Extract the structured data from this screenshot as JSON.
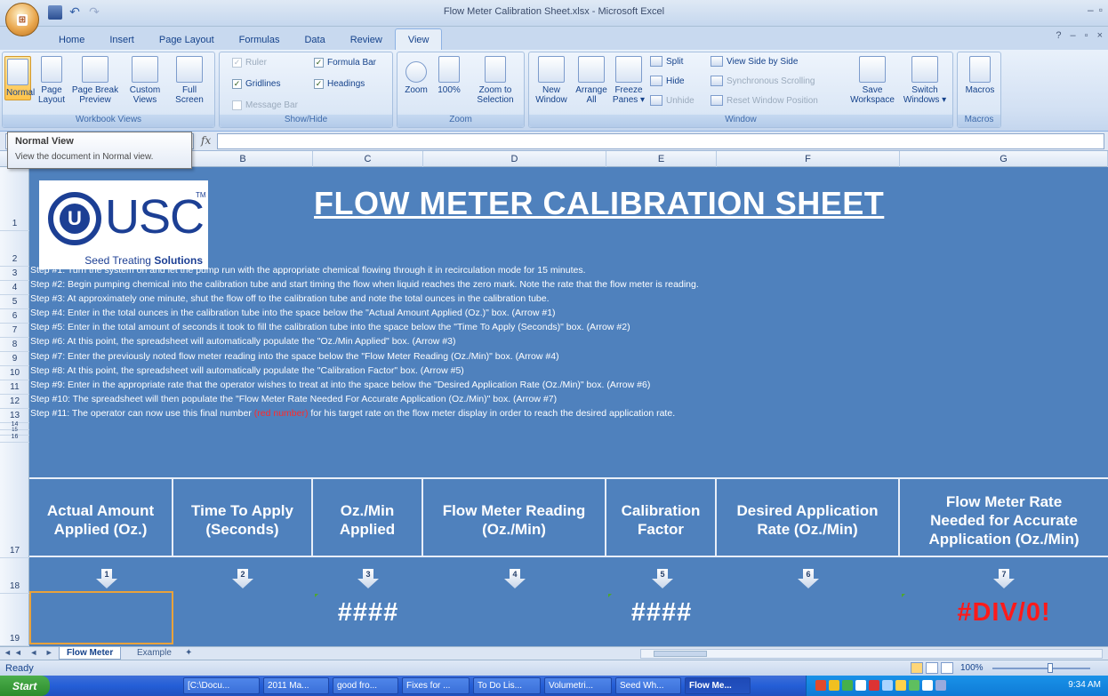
{
  "window": {
    "title": "Flow Meter Calibration Sheet.xlsx - Microsoft Excel"
  },
  "tabs": [
    "Home",
    "Insert",
    "Page Layout",
    "Formulas",
    "Data",
    "Review",
    "View"
  ],
  "ribbon": {
    "workbook_views": {
      "label": "Workbook Views",
      "normal": "Normal",
      "page_layout_1": "Page",
      "page_layout_2": "Layout",
      "page_break_1": "Page Break",
      "page_break_2": "Preview",
      "custom_1": "Custom",
      "custom_2": "Views",
      "full_1": "Full",
      "full_2": "Screen"
    },
    "show_hide": {
      "label": "Show/Hide",
      "ruler": "Ruler",
      "gridlines": "Gridlines",
      "message_bar": "Message Bar",
      "formula_bar": "Formula Bar",
      "headings": "Headings"
    },
    "zoom": {
      "label": "Zoom",
      "zoom": "Zoom",
      "hundred": "100%",
      "zoom_sel_1": "Zoom to",
      "zoom_sel_2": "Selection"
    },
    "window": {
      "label": "Window",
      "new_1": "New",
      "new_2": "Window",
      "arrange_1": "Arrange",
      "arrange_2": "All",
      "freeze_1": "Freeze",
      "freeze_2": "Panes ▾",
      "split": "Split",
      "hide": "Hide",
      "unhide": "Unhide",
      "side_by_side": "View Side by Side",
      "sync_scroll": "Synchronous Scrolling",
      "reset_pos": "Reset Window Position",
      "save_ws_1": "Save",
      "save_ws_2": "Workspace",
      "switch_1": "Switch",
      "switch_2": "Windows ▾"
    },
    "macros": {
      "label": "Macros",
      "macros": "Macros"
    }
  },
  "tooltip": {
    "title": "Normal View",
    "body": "View the document in Normal view."
  },
  "formula_bar": {
    "fx": "fx"
  },
  "columns": [
    "B",
    "C",
    "D",
    "E",
    "F",
    "G"
  ],
  "rows": [
    "1",
    "2",
    "3",
    "4",
    "5",
    "6",
    "7",
    "8",
    "9",
    "10",
    "11",
    "12",
    "13",
    "14",
    "15",
    "16",
    "17",
    "18",
    "19"
  ],
  "logo": {
    "letter": "U",
    "brand": "USC",
    "tm": "TM",
    "tag_plain": "Seed Treating ",
    "tag_bold": "Solutions"
  },
  "sheet_title": "FLOW METER CALIBRATION SHEET",
  "steps": [
    "Step #1: Turn the system on and let the pump run with the appropriate chemical flowing through it in recirculation mode for 15 minutes.",
    "Step #2: Begin pumping chemical into the calibration tube and start timing the flow when liquid reaches the zero mark.  Note the rate that the flow meter is reading.",
    "Step #3: At approximately one minute, shut the flow off to the calibration tube and note the total ounces in the calibration tube.",
    "Step #4: Enter in the total ounces in the calibration tube into the space below the \"Actual Amount Applied (Oz.)\" box. (Arrow #1)",
    "Step #5: Enter in the total amount of seconds it took to fill the calibration tube into the space below the \"Time To Apply (Seconds)\" box. (Arrow #2)",
    "Step #6: At this point, the spreadsheet will automatically populate the \"Oz./Min Applied\" box.  (Arrow #3)",
    "Step #7: Enter the previously noted flow meter reading into the space below the \"Flow Meter Reading (Oz./Min)\" box.  (Arrow #4)",
    "Step #8: At this point, the spreadsheet will automatically populate the \"Calibration Factor\" box.  (Arrow #5)",
    "Step #9: Enter in the appropriate rate that the operator wishes to treat at into the space below the \"Desired Application Rate (Oz./Min)\" box.  (Arrow #6)",
    "Step #10: The spreadsheet will then populate the \"Flow Meter Rate Needed For Accurate Application (Oz./Min)\" box.  (Arrow #7)"
  ],
  "step11": {
    "before": "Step #11: The operator can now use this final number ",
    "red": "(red number)",
    "after": " for his target rate on the flow meter display in order to reach the desired application rate."
  },
  "headers": [
    {
      "l1": "Actual Amount",
      "l2": "Applied (Oz.)",
      "l3": ""
    },
    {
      "l1": "Time To Apply",
      "l2": "(Seconds)",
      "l3": ""
    },
    {
      "l1": "Oz./Min",
      "l2": "Applied",
      "l3": ""
    },
    {
      "l1": "Flow Meter Reading",
      "l2": "(Oz./Min)",
      "l3": ""
    },
    {
      "l1": "Calibration",
      "l2": "Factor",
      "l3": ""
    },
    {
      "l1": "Desired Application",
      "l2": "Rate (Oz./Min)",
      "l3": ""
    },
    {
      "l1": "Flow Meter Rate",
      "l2": "Needed for Accurate",
      "l3": "Application (Oz./Min)"
    }
  ],
  "arrows": [
    "1",
    "2",
    "3",
    "4",
    "5",
    "6",
    "7"
  ],
  "values": {
    "oz_min": "####",
    "cal_factor": "####",
    "result": "#DIV/0!"
  },
  "sheet_tabs": {
    "nav": "◄◄ ◄ ► ►►",
    "active": "Flow Meter",
    "other": "Example"
  },
  "status": {
    "ready": "Ready",
    "zoom": "100%"
  },
  "taskbar": {
    "start": "Start",
    "items": [
      "[C:\\Docu...",
      "2011 Ma...",
      "good fro...",
      "Fixes for ...",
      "To Do Lis...",
      "Volumetri...",
      "Seed Wh...",
      "Flow Me..."
    ],
    "clock": "9:34 AM"
  },
  "colors": {
    "sheet_bg": "#4f81bd",
    "error_red": "#ff1a1a"
  }
}
